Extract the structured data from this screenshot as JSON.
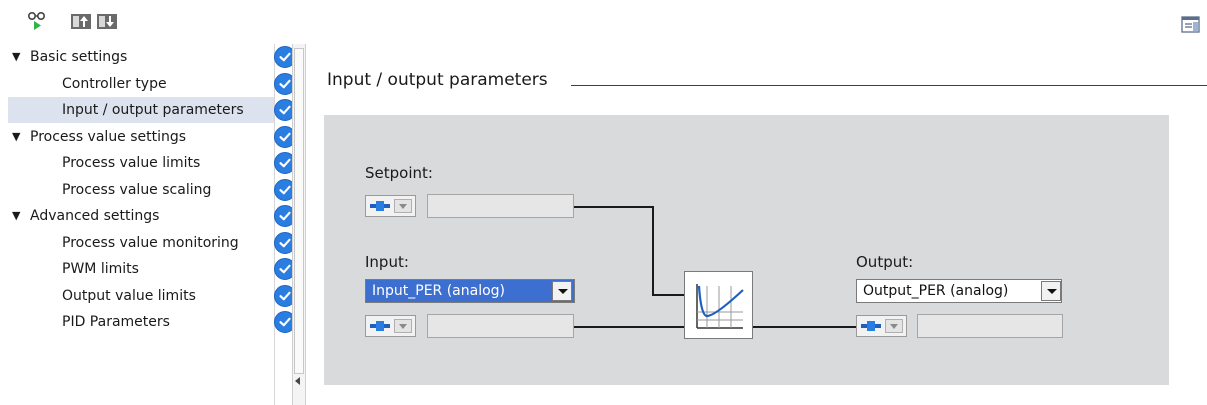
{
  "toolbar": {
    "buttons": [
      {
        "icon": "monitor-glasses-icon"
      },
      {
        "icon": "upload-to-device-icon"
      },
      {
        "icon": "download-from-device-icon"
      }
    ],
    "right_icon": "window-layout-icon"
  },
  "nav": {
    "items": [
      {
        "label": "Basic settings",
        "level": 0,
        "expanded": true,
        "selected": false
      },
      {
        "label": "Controller type",
        "level": 1,
        "selected": false
      },
      {
        "label": "Input / output parameters",
        "level": 1,
        "selected": true
      },
      {
        "label": "Process value settings",
        "level": 0,
        "expanded": true,
        "selected": false
      },
      {
        "label": "Process value limits",
        "level": 1,
        "selected": false
      },
      {
        "label": "Process value scaling",
        "level": 1,
        "selected": false
      },
      {
        "label": "Advanced settings",
        "level": 0,
        "expanded": true,
        "selected": false
      },
      {
        "label": "Process value monitoring",
        "level": 1,
        "selected": false
      },
      {
        "label": "PWM limits",
        "level": 1,
        "selected": false
      },
      {
        "label": "Output value limits",
        "level": 1,
        "selected": false
      },
      {
        "label": "PID Parameters",
        "level": 1,
        "selected": false
      }
    ],
    "status_icon": "check-circle-icon"
  },
  "main": {
    "section_title": "Input / output parameters",
    "setpoint": {
      "label": "Setpoint:",
      "value": ""
    },
    "input": {
      "label": "Input:",
      "selected": "Input_PER (analog)",
      "value": ""
    },
    "output": {
      "label": "Output:",
      "selected": "Output_PER (analog)",
      "value": ""
    },
    "pid_block_icon": "pid-controller-graph-icon"
  },
  "colors": {
    "check_blue": "#2a7de1",
    "selected_row": "#dde3ee",
    "selected_input_bg": "#3d6fd1",
    "panel_bg": "#d9dadb"
  }
}
